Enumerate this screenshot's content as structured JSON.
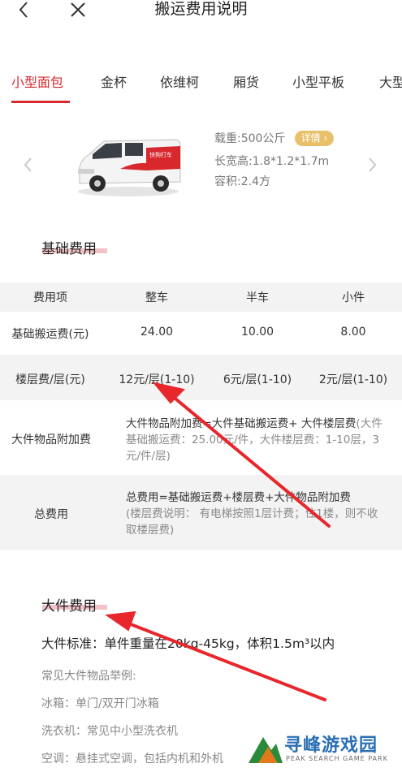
{
  "header": {
    "title": "搬运费用说明",
    "back_icon": "back-chevron-icon",
    "close_icon": "close-icon"
  },
  "tabs": [
    {
      "label": "小型面包",
      "active": true
    },
    {
      "label": "金杯",
      "active": false
    },
    {
      "label": "依维柯",
      "active": false
    },
    {
      "label": "厢货",
      "active": false
    },
    {
      "label": "小型平板",
      "active": false
    },
    {
      "label": "大型",
      "active": false
    }
  ],
  "vehicle": {
    "load_label": "载重:500公斤",
    "detail_label": "详情",
    "size_label": "长宽高:1.8*1.2*1.7m",
    "volume_label": "容积:2.4方",
    "van_brand_text": "快狗打车"
  },
  "base_fee": {
    "title": "基础费用",
    "headers": [
      "费用项",
      "整车",
      "半车",
      "小件"
    ],
    "rows": [
      [
        "基础搬运费(元)",
        "24.00",
        "10.00",
        "8.00"
      ],
      [
        "楼层费/层(元)",
        "12元/层(1-10)",
        "6元/层(1-10)",
        "2元/层(1-10)"
      ]
    ],
    "bulky_row": {
      "label": "大件物品附加费",
      "main": "大件物品附加费=大件基础搬运费+ 大件楼层费",
      "sub": "(大件基础搬运费：25.00元/件，大件楼层费：1-10层，3元/件/层)"
    },
    "total_row": {
      "label": "总费用",
      "main": "总费用=基础搬运费+楼层费+大件物品附加费",
      "sub": "(楼层费说明： 有电梯按照1层计费；住1楼，则不收取楼层费)"
    }
  },
  "bulky": {
    "title": "大件费用",
    "standard": "大件标准：单件重量在20kg-45kg，体积1.5m³以内",
    "examples_title": "常见大件物品举例:",
    "examples": [
      "冰箱：单门/双开门冰箱",
      "洗衣机：常见中小型洗衣机",
      "空调：悬挂式空调，包括内机和外机"
    ]
  },
  "watermark": {
    "title": "寻峰游戏园",
    "subtitle": "PEAK SEARCH GAME PARK"
  },
  "colors": {
    "accent": "#d8282e",
    "badge": "#e9c06a",
    "row_gray": "#f3f3f3",
    "annotation_arrow": "#e8262c"
  }
}
